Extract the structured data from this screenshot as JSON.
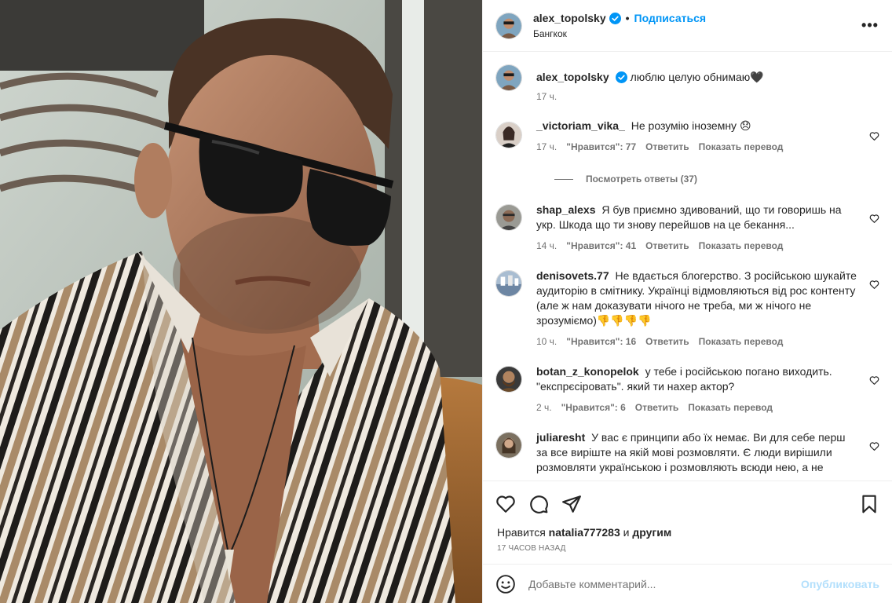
{
  "post": {
    "username": "alex_topolsky",
    "follow_label": "Подписаться",
    "location": "Бангкок",
    "more_label": "•••"
  },
  "caption": {
    "username": "alex_topolsky",
    "text": "люблю целую обнимаю🖤",
    "time": "17 ч."
  },
  "comments": [
    {
      "username": "_victoriam_vika_",
      "text": "Не розумію іноземну 😞",
      "time": "17 ч.",
      "likes": "\"Нравится\": 77",
      "reply": "Ответить",
      "translate": "Показать перевод",
      "view_replies": "Посмотреть ответы (37)"
    },
    {
      "username": "shap_alexs",
      "text": "Я був приємно здивований, що ти говоришь на укр. Шкода що ти знову перейшов на це бекання...",
      "time": "14 ч.",
      "likes": "\"Нравится\": 41",
      "reply": "Ответить",
      "translate": "Показать перевод"
    },
    {
      "username": "denisovets.77",
      "text": "Не вдається блогерство. З російською шукайте аудиторію в смітнику. Українці відмовляються від рос контенту (але ж нам доказувати нічого не треба, ми ж нічого не зрозуміємо)👎👎👎👎",
      "time": "10 ч.",
      "likes": "\"Нравится\": 16",
      "reply": "Ответить",
      "translate": "Показать перевод"
    },
    {
      "username": "botan_z_konopelok",
      "text": "у тебе і російською погано виходить. \"експрєсіровать\". який ти нахер актор?",
      "time": "2 ч.",
      "likes": "\"Нравится\": 6",
      "reply": "Ответить",
      "translate": "Показать перевод"
    },
    {
      "username": "juliaresht",
      "text": "У вас є принципи або їх немає. Ви для себе перш за все вирiште на якiй мовi розмовляти. Є люди вирішили розмовляти українською і розмовляють всюди нею, а не",
      "time": "",
      "likes": "",
      "reply": "",
      "translate": ""
    }
  ],
  "likes_line": {
    "prefix": "Нравится",
    "user": "natalia777283",
    "middle": "и",
    "others": "другим"
  },
  "time_ago": "17 часов назад",
  "add_comment": {
    "placeholder": "Добавьте комментарий...",
    "publish": "Опубликовать"
  },
  "colors": {
    "accent": "#0095f6",
    "publish_disabled": "#b2dffc",
    "muted": "#737373"
  }
}
